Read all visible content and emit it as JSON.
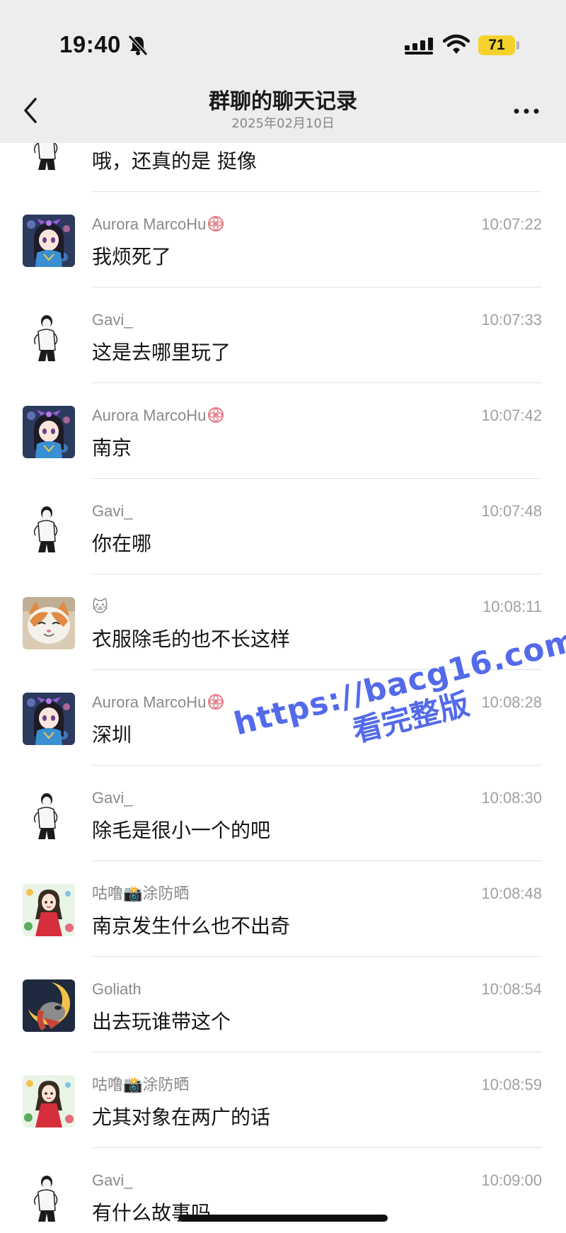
{
  "status_bar": {
    "time": "19:40",
    "battery": "71"
  },
  "nav": {
    "title": "群聊的聊天记录",
    "subtitle": "2025年02月10日"
  },
  "messages": [
    {
      "sender": "",
      "badge": false,
      "time": "",
      "text": "哦，还真的是 挺像",
      "avatar": "man-sketch"
    },
    {
      "sender": "Aurora MarcoHu",
      "badge": true,
      "time": "10:07:22",
      "text": "我烦死了",
      "avatar": "anime-girl"
    },
    {
      "sender": "Gavi_",
      "badge": false,
      "time": "10:07:33",
      "text": "这是去哪里玩了",
      "avatar": "man-sketch"
    },
    {
      "sender": "Aurora MarcoHu",
      "badge": true,
      "time": "10:07:42",
      "text": "南京",
      "avatar": "anime-girl"
    },
    {
      "sender": "Gavi_",
      "badge": false,
      "time": "10:07:48",
      "text": "你在哪",
      "avatar": "man-sketch"
    },
    {
      "sender": "🐱",
      "badge": false,
      "time": "10:08:11",
      "text": "衣服除毛的也不长这样",
      "avatar": "cat-photo"
    },
    {
      "sender": "Aurora MarcoHu",
      "badge": true,
      "time": "10:08:28",
      "text": "深圳",
      "avatar": "anime-girl"
    },
    {
      "sender": "Gavi_",
      "badge": false,
      "time": "10:08:30",
      "text": "除毛是很小一个的吧",
      "avatar": "man-sketch"
    },
    {
      "sender": "咕噜📸涂防晒",
      "badge": false,
      "time": "10:08:48",
      "text": "南京发生什么也不出奇",
      "avatar": "red-dress-girl"
    },
    {
      "sender": "Goliath",
      "badge": false,
      "time": "10:08:54",
      "text": "出去玩谁带这个",
      "avatar": "cartoon-dog"
    },
    {
      "sender": "咕噜📸涂防晒",
      "badge": false,
      "time": "10:08:59",
      "text": "尤其对象在两广的话",
      "avatar": "red-dress-girl"
    },
    {
      "sender": "Gavi_",
      "badge": false,
      "time": "10:09:00",
      "text": "有什么故事吗",
      "avatar": "man-sketch"
    }
  ],
  "watermark": {
    "url": "https://bacg16.com",
    "caption": "看完整版",
    "color": "#4a63e8"
  },
  "colors": {
    "header_bg": "#ededed",
    "battery": "#f4d22b",
    "badge": "#e57c86"
  }
}
